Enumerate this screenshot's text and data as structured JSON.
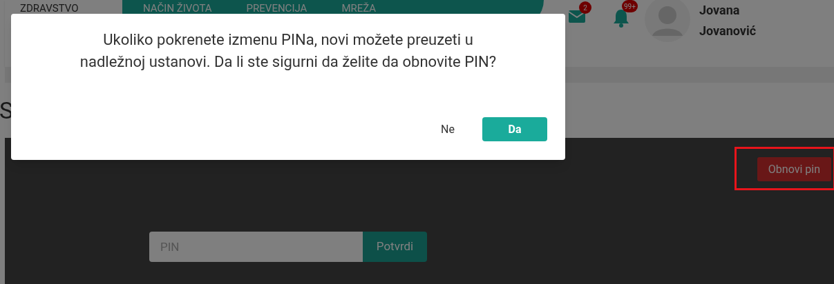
{
  "header": {
    "logo_text": "ZDRAVSTVO",
    "nav": [
      {
        "label": "NAČIN ŽIVOTA"
      },
      {
        "label": "PREVENCIJA"
      },
      {
        "label": "MREŽA"
      }
    ],
    "messages_badge": "2",
    "notifications_badge": "99+",
    "user_name": [
      "Jovana",
      "Jovanović"
    ]
  },
  "page_title": "S",
  "renew_button": "Obnovi pin",
  "pin_form": {
    "placeholder": "PIN",
    "submit": "Potvrdi"
  },
  "dialog": {
    "message": "Ukoliko pokrenete izmenu PINa, novi možete preuzeti u nadležnoj ustanovi. Da li ste sigurni da želite da obnovite PIN?",
    "buttons": [
      {
        "label": "Ne",
        "kind": "text"
      },
      {
        "label": "Da",
        "kind": "primary"
      }
    ]
  }
}
